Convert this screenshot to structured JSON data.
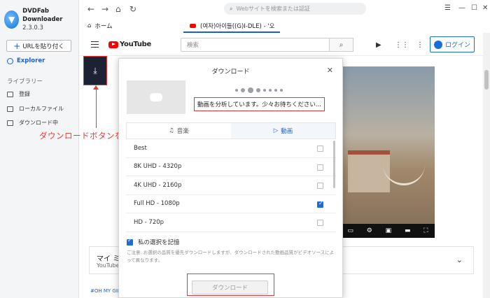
{
  "app": {
    "name": "DVDFab Downloader",
    "version": "2.3.0.3"
  },
  "sidebar": {
    "paste_url_label": "URLを貼り付く",
    "explorer_label": "Explorer",
    "library_title": "ライブラリー",
    "items": [
      {
        "label": "登録"
      },
      {
        "label": "ローカルファイル"
      },
      {
        "label": "ダウンロード中"
      }
    ]
  },
  "browser": {
    "address_placeholder": "Webサイトを検索または認証",
    "tabs": [
      {
        "label": "ホーム"
      },
      {
        "label": "(여자)아이들((G)I-DLE) - '오"
      }
    ]
  },
  "youtube": {
    "logo_text": "YouTube",
    "search_placeholder": "検索",
    "login_label": "ログイン",
    "playlist_title": "マイ ミ",
    "playlist_sub": "YouTube",
    "tags": "#OH MY GIRL"
  },
  "annotation": {
    "text": "ダウンロードボタンを押す"
  },
  "dialog": {
    "title": "ダウンロード",
    "status": "動画を分析しています。少々お待ちください...",
    "tab_audio": "音楽",
    "tab_video": "動画",
    "qualities": [
      {
        "label": "Best",
        "checked": false
      },
      {
        "label": "8K UHD - 4320p",
        "checked": false
      },
      {
        "label": "4K UHD - 2160p",
        "checked": false
      },
      {
        "label": "Full HD - 1080p",
        "checked": true
      },
      {
        "label": "HD - 720p",
        "checked": false
      }
    ],
    "remember_label": "私の選択を記憶",
    "note": "ご注意: お選択の品質を優先ダウンロードしますが、ダウンロードされた動画品質がビデオソースによって異なります。",
    "download_label": "ダウンロード"
  },
  "colors": {
    "accent": "#1a6ed8",
    "annotation": "#e53935",
    "youtube_red": "#ff0000"
  }
}
